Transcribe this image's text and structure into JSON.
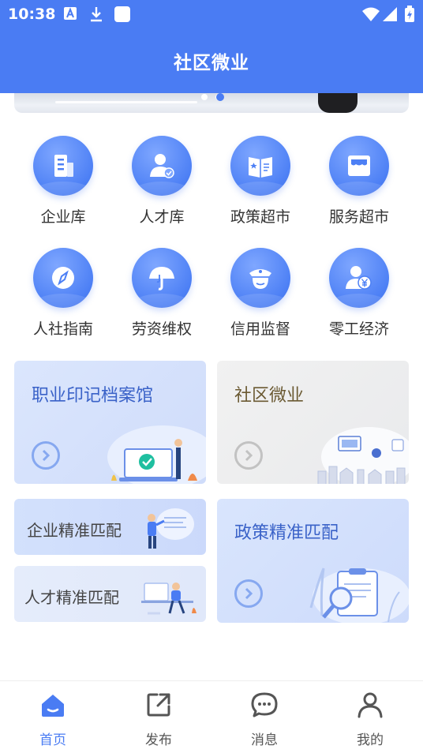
{
  "status_bar": {
    "time": "10:38"
  },
  "header": {
    "title": "社区微业"
  },
  "grid": [
    {
      "label": "企业库",
      "icon": "building-icon"
    },
    {
      "label": "人才库",
      "icon": "person-check-icon"
    },
    {
      "label": "政策超市",
      "icon": "policy-book-icon"
    },
    {
      "label": "服务超市",
      "icon": "store-icon"
    },
    {
      "label": "人社指南",
      "icon": "compass-icon"
    },
    {
      "label": "劳资维权",
      "icon": "umbrella-icon"
    },
    {
      "label": "信用监督",
      "icon": "officer-icon"
    },
    {
      "label": "零工经济",
      "icon": "yuan-person-icon"
    }
  ],
  "cards": {
    "archive": {
      "title": "职业印记档案馆"
    },
    "micro": {
      "title": "社区微业"
    },
    "enterprise_match": {
      "title": "企业精准匹配"
    },
    "talent_match": {
      "title": "人才精准匹配"
    },
    "policy_match": {
      "title": "政策精准匹配"
    }
  },
  "nav": [
    {
      "label": "首页",
      "icon": "home-icon",
      "active": true
    },
    {
      "label": "发布",
      "icon": "share-icon",
      "active": false
    },
    {
      "label": "消息",
      "icon": "message-icon",
      "active": false
    },
    {
      "label": "我的",
      "icon": "user-icon",
      "active": false
    }
  ],
  "colors": {
    "primary": "#4a7cf3",
    "text": "#333333",
    "nav_inactive": "#555555"
  }
}
